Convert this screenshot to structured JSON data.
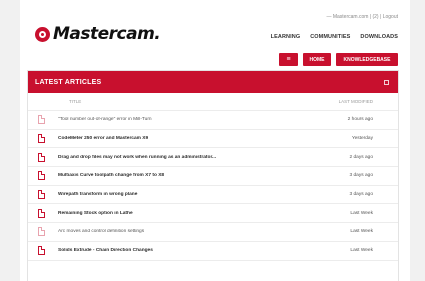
{
  "user_bar": {
    "account": "— Mastercam.com",
    "separator1": "|",
    "flag": "(2)",
    "separator2": "|",
    "logout": "Logout"
  },
  "brand": {
    "logo_text": "Mastercam.",
    "accent_color": "#c8102e"
  },
  "main_nav": [
    "LEARNING",
    "COMMUNITIES",
    "DOWNLOADS"
  ],
  "buttons": {
    "menu_icon": "≡",
    "home": "HOME",
    "knowledgebase": "KNOWLEDGEBASE"
  },
  "panel": {
    "title": "LATEST ARTICLES",
    "col_title": "TITLE",
    "col_modified": "LAST MODIFIED"
  },
  "articles": [
    {
      "title": "\"Tool number out-of-range\" error in Mill-Turn",
      "date": "2 hours ago",
      "read": true
    },
    {
      "title": "CodeMeter 250 error and Mastercam X9",
      "date": "Yesterday",
      "read": false
    },
    {
      "title": "Drag and drop files may not work when running as an administrator...",
      "date": "2 days ago",
      "read": false
    },
    {
      "title": "Multiaxis Curve toolpath change from X7 to X8",
      "date": "3 days ago",
      "read": false
    },
    {
      "title": "Wirepath transform in wrong plane",
      "date": "3 days ago",
      "read": false
    },
    {
      "title": "Remaining Stock option in Lathe",
      "date": "Last Week",
      "read": false
    },
    {
      "title": "Arc moves and control definition settings",
      "date": "Last Week",
      "read": true
    },
    {
      "title": "Solids Extrude - Chain Direction Changes",
      "date": "Last Week",
      "read": false
    }
  ]
}
